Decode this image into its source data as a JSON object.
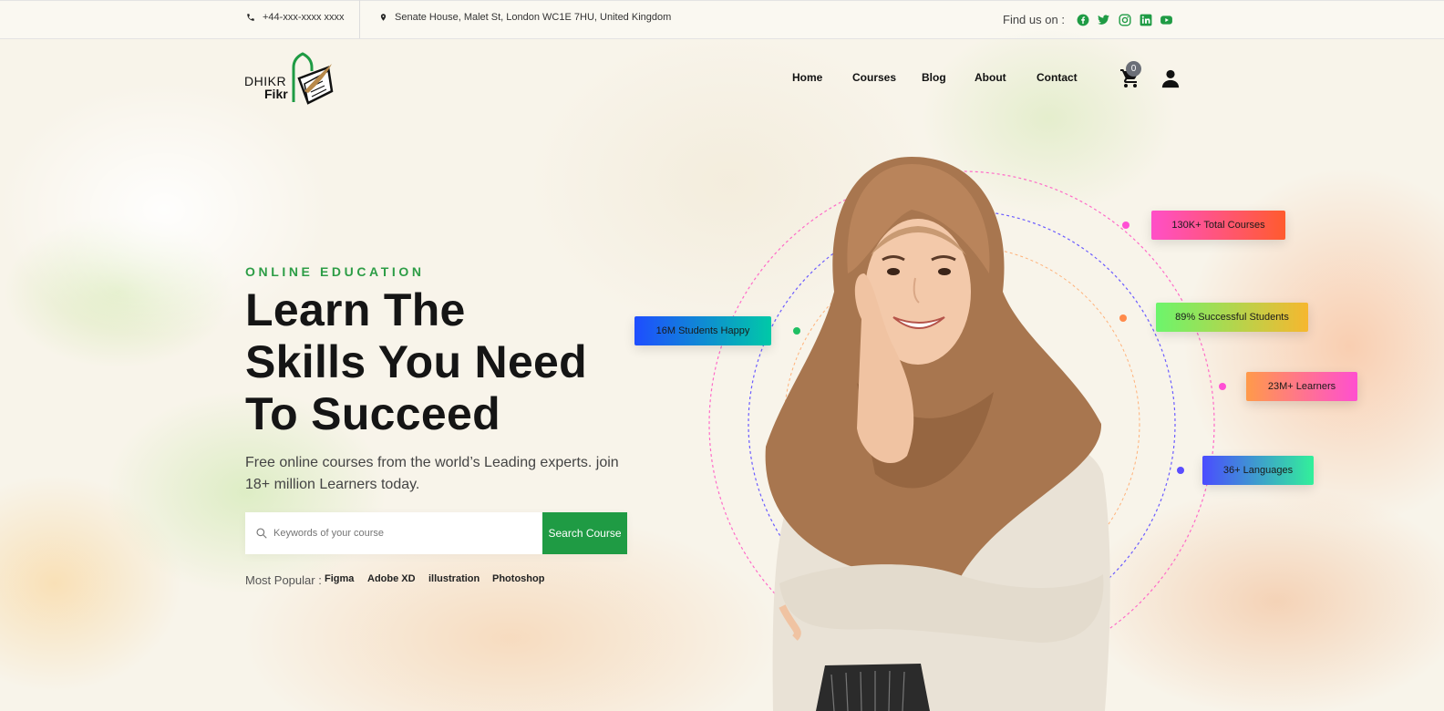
{
  "topbar": {
    "phone": "+44-xxx-xxxx xxxx",
    "address": "Senate House, Malet St, London WC1E 7HU, United Kingdom",
    "find_us": "Find us on :",
    "socials": [
      "facebook-icon",
      "twitter-icon",
      "instagram-icon",
      "linkedin-icon",
      "youtube-icon"
    ],
    "social_color": "#1f9b44"
  },
  "logo": {
    "line1": "DHIKR",
    "line2": "Fikr"
  },
  "nav": {
    "items": [
      "Home",
      "Courses",
      "Blog",
      "About",
      "Contact"
    ]
  },
  "cart": {
    "count": "0"
  },
  "hero": {
    "eyebrow": "ONLINE EDUCATION",
    "headline_lines": [
      "Learn The",
      "Skills You Need",
      "To Succeed"
    ],
    "subtitle": "Free online courses from the world’s Leading experts. join 18+ million Learners today.",
    "search": {
      "placeholder": "Keywords of your course",
      "button": "Search Course"
    },
    "popular_label": "Most Popular :",
    "popular_tags": [
      "Figma",
      "Adobe XD",
      "illustration",
      "Photoshop"
    ]
  },
  "stats": [
    {
      "label": "130K+ Total Courses",
      "colors": [
        "#ff4fc8",
        "#ff5b2e"
      ],
      "dot": "#ff4fd4"
    },
    {
      "label": "16M Students Happy",
      "colors": [
        "#1e4dff",
        "#00c9a7"
      ],
      "dot": "#1fbf63"
    },
    {
      "label": "89% Successful Students",
      "colors": [
        "#6cf56c",
        "#f6b72f"
      ],
      "dot": "#ff8a4a"
    },
    {
      "label": "23M+ Learners",
      "colors": [
        "#ff9a4a",
        "#ff4fd0"
      ],
      "dot": "#ff4fd4"
    },
    {
      "label": "36+ Languages",
      "colors": [
        "#4a4cff",
        "#32f09a"
      ],
      "dot": "#5a4dff"
    }
  ],
  "accent": "#1f9b44"
}
